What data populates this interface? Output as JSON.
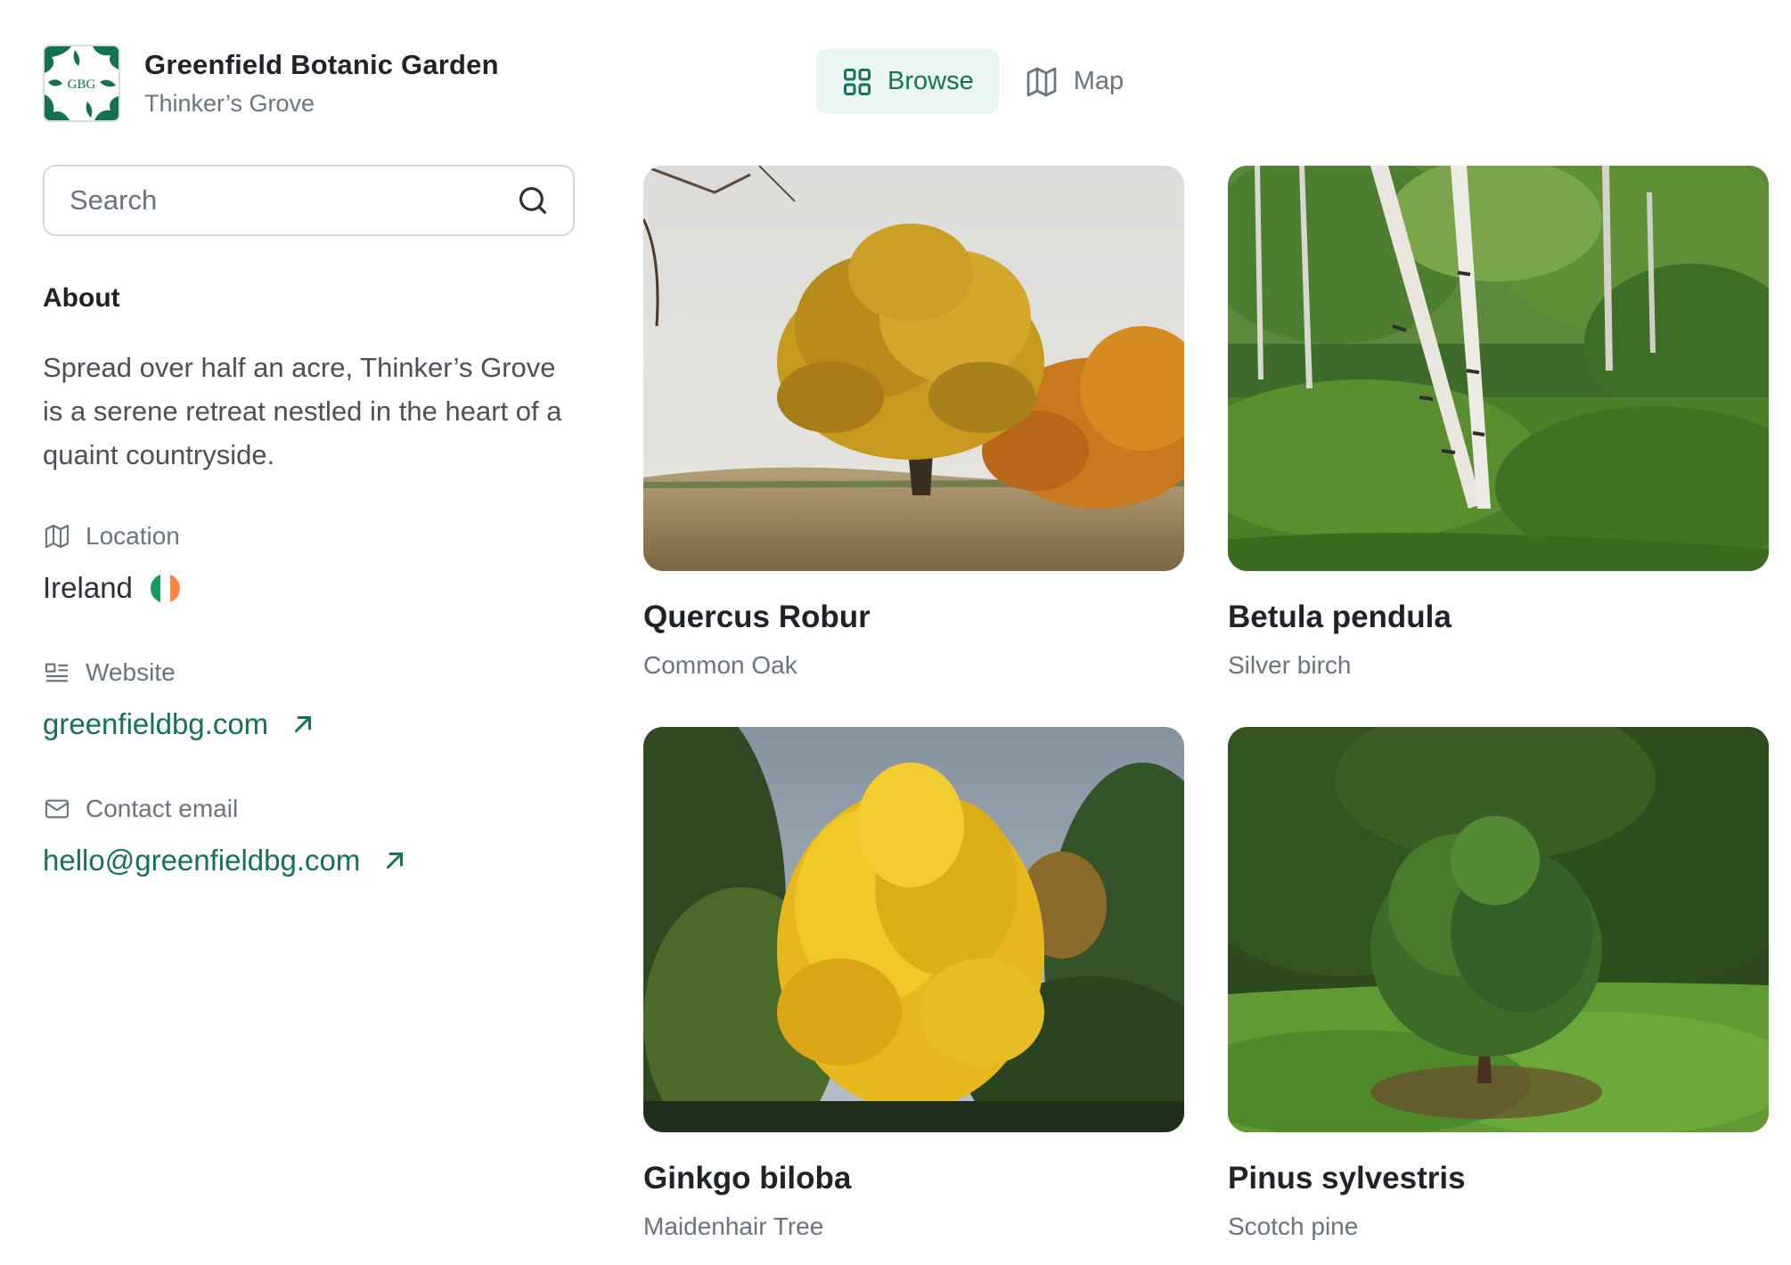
{
  "header": {
    "title": "Greenfield Botanic Garden",
    "subtitle": "Thinker’s Grove",
    "logo_text": "GBG",
    "logo_icon": "leaf-pattern-logo"
  },
  "nav": {
    "tabs": [
      {
        "label": "Browse",
        "icon": "grid-icon",
        "active": true
      },
      {
        "label": "Map",
        "icon": "map-icon",
        "active": false
      }
    ]
  },
  "search": {
    "placeholder": "Search",
    "value": "",
    "icon": "search-icon"
  },
  "about": {
    "heading": "About",
    "text": "Spread over half an acre, Thinker’s Grove is a serene retreat nestled in the heart of a quaint countryside."
  },
  "location": {
    "label": "Location",
    "icon": "map-icon",
    "value": "Ireland",
    "flag_colors": [
      "#169b62",
      "#ffffff",
      "#ff883e"
    ]
  },
  "website": {
    "label": "Website",
    "icon": "browser-icon",
    "value": "greenfieldbg.com",
    "link_icon": "arrow-up-right-icon"
  },
  "contact": {
    "label": "Contact email",
    "icon": "mail-icon",
    "value": "hello@greenfieldbg.com",
    "link_icon": "arrow-up-right-icon"
  },
  "trees": [
    {
      "name": "Quercus Robur",
      "common": "Common Oak"
    },
    {
      "name": "Betula pendula",
      "common": "Silver birch"
    },
    {
      "name": "Ginkgo biloba",
      "common": "Maidenhair Tree"
    },
    {
      "name": "Pinus sylvestris",
      "common": "Scotch pine"
    }
  ],
  "colors": {
    "accent": "#16705a",
    "accent_bg": "#eaf6f1",
    "muted_text": "#6b7280",
    "border": "#d4d8dd"
  }
}
